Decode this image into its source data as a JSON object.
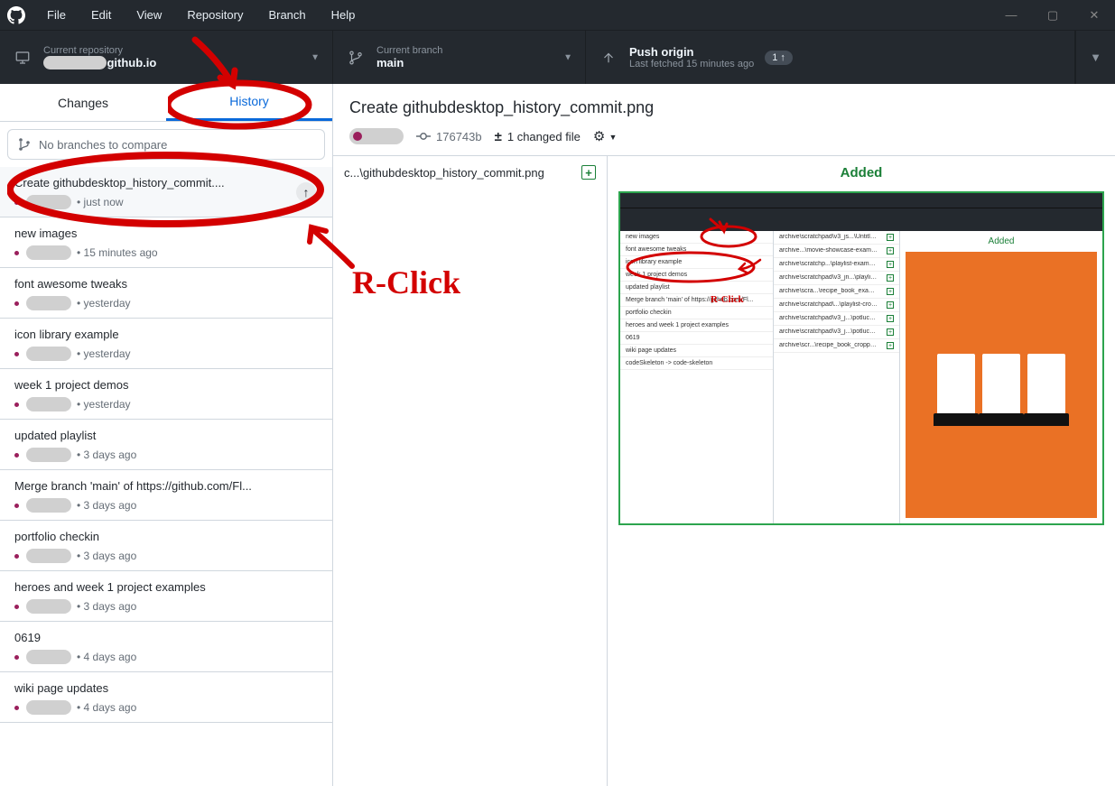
{
  "menu": {
    "items": [
      "File",
      "Edit",
      "View",
      "Repository",
      "Branch",
      "Help"
    ]
  },
  "header": {
    "repo": {
      "label": "Current repository",
      "value_suffix": "github.io"
    },
    "branch": {
      "label": "Current branch",
      "value": "main"
    },
    "push": {
      "label": "Push origin",
      "sub": "Last fetched 15 minutes ago",
      "badge": "1 ↑"
    }
  },
  "tabs": {
    "changes": "Changes",
    "history": "History"
  },
  "compare": "No branches to compare",
  "commits": [
    {
      "title": "Create githubdesktop_history_commit....",
      "time": "just now",
      "selected": true,
      "pending": true
    },
    {
      "title": "new images",
      "time": "15 minutes ago"
    },
    {
      "title": "font awesome tweaks",
      "time": "yesterday"
    },
    {
      "title": "icon library example",
      "time": "yesterday"
    },
    {
      "title": "week 1 project demos",
      "time": "yesterday"
    },
    {
      "title": "updated playlist",
      "time": "3 days ago"
    },
    {
      "title": "Merge branch 'main' of https://github.com/Fl...",
      "time": "3 days ago"
    },
    {
      "title": "portfolio checkin",
      "time": "3 days ago"
    },
    {
      "title": "heroes and week 1 project examples",
      "time": "3 days ago"
    },
    {
      "title": "0619",
      "time": "4 days ago"
    },
    {
      "title": "wiki page updates",
      "time": "4 days ago"
    }
  ],
  "detail": {
    "title": "Create githubdesktop_history_commit.png",
    "sha": "176743b",
    "files_count": "1 changed file",
    "file_path": "c...\\githubdesktop_history_commit.png",
    "diff_status": "Added"
  },
  "preview": {
    "added_label": "Added",
    "left_rows": [
      "new images",
      "font awesome tweaks",
      "icon library example",
      "week 1 project demos",
      "updated playlist",
      "Merge branch 'main' of https://github.com/Fl...",
      "portfolio checkin",
      "heroes and week 1 project examples",
      "0619",
      "wiki page updates",
      "codeSkeleton -> code-skeleton"
    ],
    "mid_rows": [
      "archive\\scratchpad\\v3_js...\\Untitled.png",
      "archive...\\movie-showcase-example.zip",
      "archive\\scratchp...\\playlist-example.zip",
      "archive\\scratchpad\\v3_jn...\\playlist.png",
      "archive\\scra...\\recipe_book_example.png",
      "archive\\scratchpad\\...\\playlist-cropped.png",
      "archive\\scratchpad\\v3_j...\\potluck.png",
      "archive\\scratchpad\\v3_j...\\potluck2.png",
      "archive\\scr...\\recipe_book_cropped.png"
    ]
  },
  "annotations": {
    "rclick": "R-Click"
  }
}
